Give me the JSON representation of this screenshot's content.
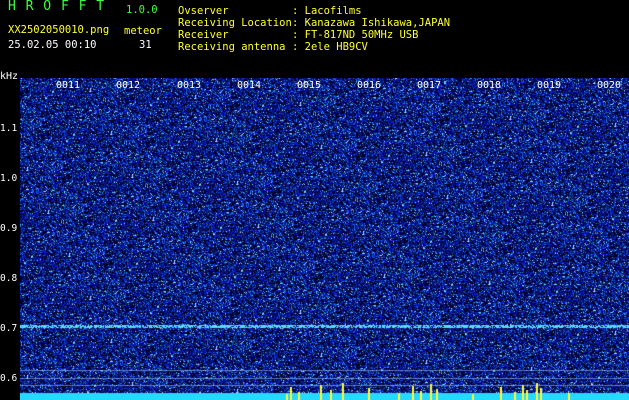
{
  "app": {
    "name": "H R O F F T",
    "version": "1.0.0",
    "filename": "XX2502050010.png",
    "datetime": "25.02.05 00:10",
    "meteor_label": "meteor",
    "meteor_count": "31"
  },
  "info": [
    {
      "key": "Ovserver",
      "value": ": Lacofilms"
    },
    {
      "key": "Receiving Location",
      "value": ": Kanazawa Ishikawa,JAPAN"
    },
    {
      "key": "Receiver",
      "value": ": FT-817ND 50MHz USB"
    },
    {
      "key": "Receiving antenna",
      "value": ": 2ele HB9CV"
    }
  ],
  "axis": {
    "unit": "kHz",
    "y_ticks": [
      "1.1",
      "1.0",
      "0.9",
      "0.8",
      "0.7",
      "0.6"
    ],
    "time_labels": [
      "0011",
      "0012",
      "0013",
      "0014",
      "0015",
      "0016",
      "0017",
      "0018",
      "0019",
      "0020"
    ]
  },
  "colors": {
    "background": "#000000",
    "noise_blue": "#1a2cc8",
    "signal_cyan": "#39e0ff",
    "meteor_yellow": "#ffff30",
    "title_green": "#3cff3c"
  }
}
